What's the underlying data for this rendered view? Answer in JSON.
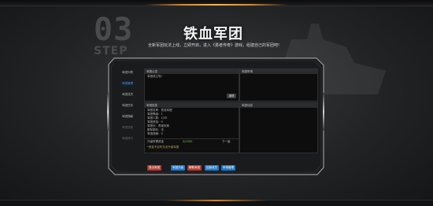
{
  "header": {
    "step_number": "03",
    "step_word": "STEP",
    "title": "铁血军团",
    "subtitle": "全新军团玩法上线，立即开启，进入《勇者传奇》游戏，组建自己的军团吧!"
  },
  "sidebar": {
    "items": [
      {
        "label": "军团列表",
        "state": "normal"
      },
      {
        "label": "军团管理",
        "state": "active"
      },
      {
        "label": "军团成员",
        "state": "normal"
      },
      {
        "label": "军团任务",
        "state": "normal"
      },
      {
        "label": "军团捐献",
        "state": "normal"
      },
      {
        "label": "军团战役",
        "state": "disabled"
      },
      {
        "label": "军团排行",
        "state": "disabled"
      }
    ]
  },
  "announcement_panel": {
    "header": "军团公告",
    "text": "军团成立啦!",
    "edit_button": "编辑"
  },
  "apply_panel": {
    "header": "军团申请"
  },
  "info_panel": {
    "header": "军团信息",
    "lines": [
      "军团名称：铁血军团",
      "军团等级：1",
      "军团人数：1/30",
      "军团资金：0",
      "军团长：勇者玩家",
      "副军团长：无",
      "军团贡献：0"
    ]
  },
  "upgrade": {
    "label": "升级所需资金",
    "value": "0/1000",
    "next_label": "下一级",
    "note": "*资金不足时无法升级军团"
  },
  "log_panel": {
    "header": "军团动态"
  },
  "buttons": {
    "quit": "退出军团",
    "upgrade": "军团升级",
    "disband": "解散军团",
    "recruit": "招募成员",
    "apply": "申请管理"
  },
  "colors": {
    "accent_blue": "#1e78c8",
    "danger_red": "#b23a2e",
    "active_text": "#3aa0ff",
    "orange_glow": "#f2b25a"
  }
}
